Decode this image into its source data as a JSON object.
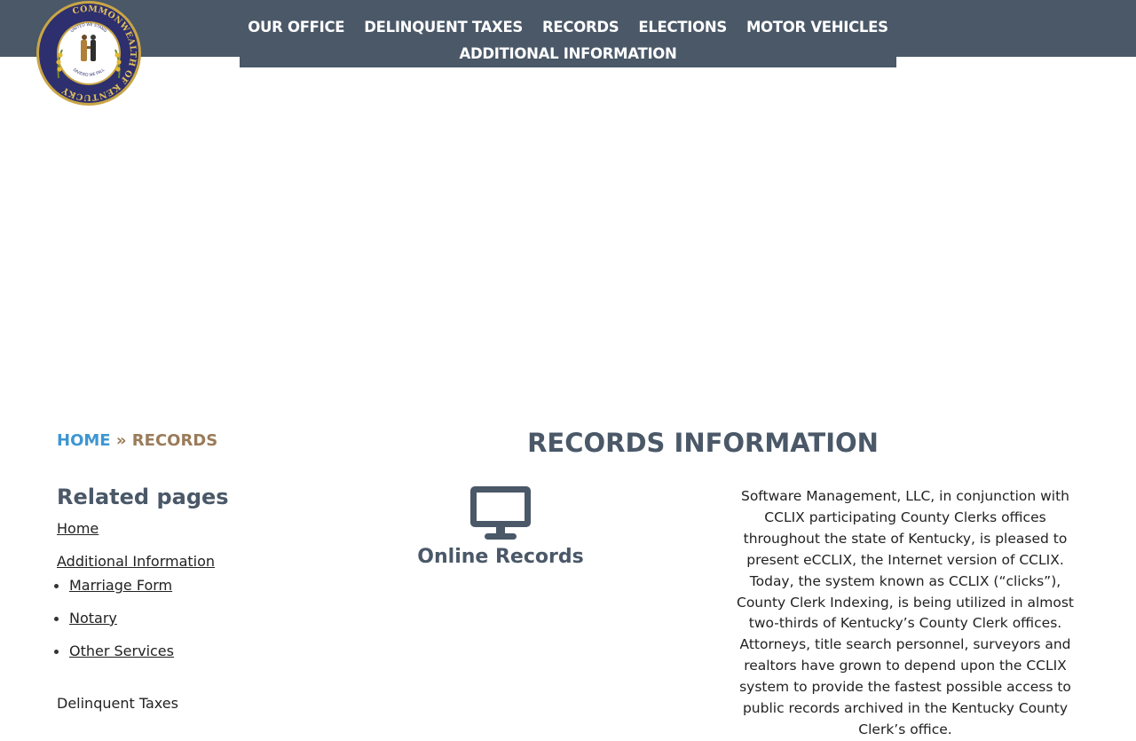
{
  "nav": {
    "items": [
      "OUR OFFICE",
      "DELINQUENT TAXES",
      "RECORDS",
      "ELECTIONS",
      "MOTOR VEHICLES",
      "ADDITIONAL INFORMATION"
    ]
  },
  "logo": {
    "icon": "kentucky-seal-icon",
    "ring_text": "COMMONWEALTH OF KENTUCKY",
    "motto_top": "UNITED WE STAND",
    "motto_bottom": "DIVIDED WE FALL"
  },
  "breadcrumb": {
    "home": "HOME",
    "separator": "»",
    "current": "RECORDS"
  },
  "sidebar": {
    "title": "Related pages",
    "home": "Home",
    "additional": "Additional Information",
    "sub": [
      "Marriage Form",
      "Notary",
      "Other Services"
    ],
    "delinquent": "Delinquent Taxes"
  },
  "main": {
    "title": "RECORDS INFORMATION",
    "online_icon": "monitor-icon",
    "online_label": "Online Records",
    "description": "Software Management, LLC, in conjunction with CCLIX participating County Clerks offices throughout the state of Kentucky, is pleased to present eCCLIX, the Internet version of CCLIX. Today, the system known as CCLIX (“clicks”), County Clerk Indexing, is being utilized in almost two-thirds of Kentucky’s County Clerk offices. Attorneys, title search personnel, surveyors and realtors have grown to depend upon the CCLIX system to provide the fastest possible access to public records archived in the Kentucky County Clerk’s office."
  },
  "colors": {
    "header": "#4a5868",
    "link_blue": "#3d96d3",
    "breadcrumb_current": "#9a7b5a",
    "heading": "#4a5868",
    "seal_navy": "#2d2f6e",
    "seal_gold": "#c9a646"
  }
}
